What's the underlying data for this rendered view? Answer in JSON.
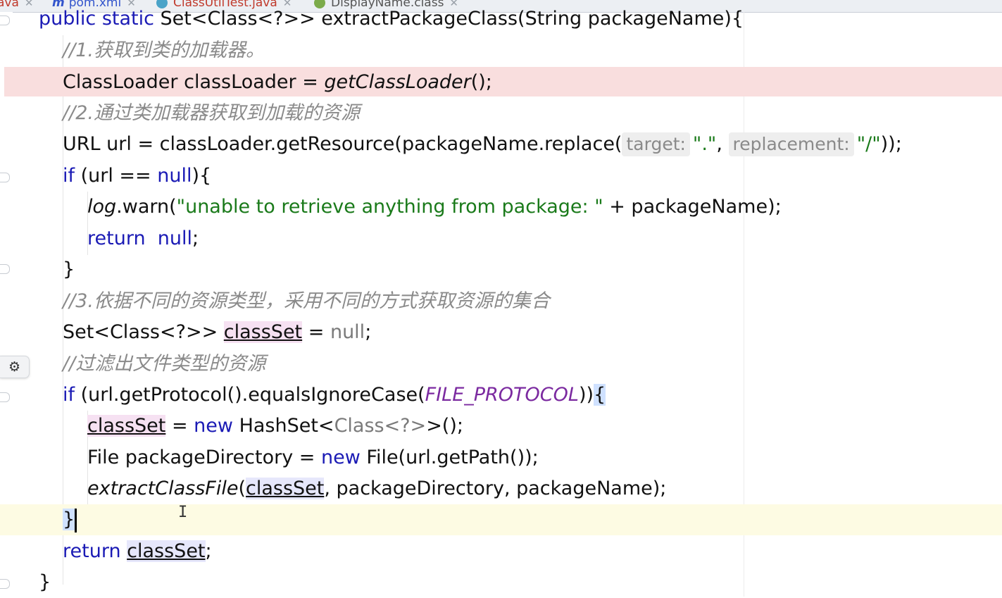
{
  "tabs": [
    {
      "label": "ava",
      "color": "#c0392b",
      "icon": ""
    },
    {
      "label": "pom.xml",
      "color": "#3355cc",
      "icon": "maven-icon"
    },
    {
      "label": "ClassUtilTest.java",
      "color": "#c0392b",
      "icon": "java-class-icon"
    },
    {
      "label": "DisplayName.class",
      "color": "#555555",
      "icon": "annotation-icon"
    }
  ],
  "editor": {
    "line01": {
      "kw1": "public static",
      "sig": " Set<Class<?>> extractPackageClass(String packageName){"
    },
    "line02": {
      "comment": "//1.获取到类的加载器。"
    },
    "line03": {
      "pre": "ClassLoader classLoader = ",
      "call": "getClassLoader",
      "post": "();"
    },
    "line04": {
      "comment": "//2.通过类加载器获取到加载的资源"
    },
    "line05": {
      "pre": "URL url = classLoader.getResource(packageName.replace(",
      "hint1": "target:",
      "arg1": "\".\"",
      "comma": ", ",
      "hint2": "replacement:",
      "arg2": "\"/\"",
      "post": "));"
    },
    "line06": {
      "kw": "if",
      "mid": " (url == ",
      "nul": "null",
      "post": "){"
    },
    "line07": {
      "log": "log",
      "mid": ".warn(",
      "str": "\"unable to retrieve anything from package: \"",
      "post": " + packageName);"
    },
    "line08": {
      "kw": "return",
      "sp": "  ",
      "nul": "null",
      "post": ";"
    },
    "line09": {
      "text": "}"
    },
    "line10": {
      "comment": "//3.依据不同的资源类型，采用不同的方式获取资源的集合"
    },
    "line11": {
      "pre": "Set<Class<?>> ",
      "var": "classSet",
      "mid": " = ",
      "nul": "null",
      "post": ";"
    },
    "line12": {
      "comment": "//过滤出文件类型的资源"
    },
    "line13": {
      "kw": "if",
      "mid": " (url.getProtocol().equalsIgnoreCase(",
      "const": "FILE_PROTOCOL",
      "close": "))",
      "brace": "{"
    },
    "line14": {
      "var": "classSet",
      "mid": " = ",
      "kw": "new",
      "mid2": " HashSet<",
      "gen": "Class<?>",
      "post": ">();"
    },
    "line15": {
      "pre": "File packageDirectory = ",
      "kw": "new",
      "post": " File(url.getPath());"
    },
    "line16": {
      "call": "extractClassFile",
      "open": "(",
      "var": "classSet",
      "post": ", packageDirectory, packageName);"
    },
    "line17": {
      "brace": "}"
    },
    "line18": {
      "kw": "return",
      "sp": " ",
      "var": "classSet",
      "post": ";"
    },
    "line19": {
      "text": "}"
    }
  },
  "colors": {
    "keyword": "#1b1bb5",
    "comment": "#8a8a8a",
    "string": "#1a7a1a",
    "constant": "#7b2aa0",
    "error_line": "#f9dede",
    "caret_line": "#fdfbe3"
  }
}
